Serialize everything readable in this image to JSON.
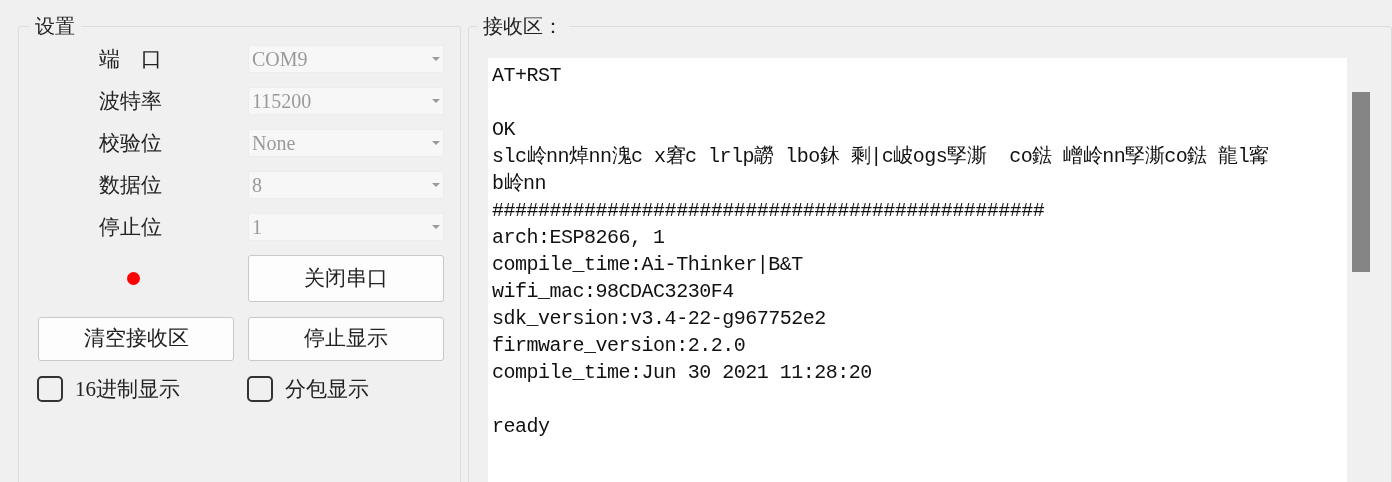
{
  "settings": {
    "title": "设置",
    "fields": [
      {
        "label": "端　口",
        "value": "COM9",
        "disabled": true
      },
      {
        "label": "波特率",
        "value": "115200",
        "disabled": true
      },
      {
        "label": "校验位",
        "value": "None",
        "disabled": true
      },
      {
        "label": "数据位",
        "value": "8",
        "disabled": true
      },
      {
        "label": "停止位",
        "value": "1",
        "disabled": true
      }
    ],
    "indicator": {
      "color": "#ff0000"
    },
    "open_button": "关闭串口",
    "buttons": [
      "清空接收区",
      "停止显示"
    ],
    "checkboxes": [
      {
        "label": "16进制显示",
        "checked": false
      },
      {
        "label": "分包显示",
        "checked": false
      }
    ]
  },
  "receive": {
    "title": "接收区：",
    "text": "AT+RST\n\nOK\nslc岭nn焯nn溾c x窘c lrlp髝 lbo鈢 剩|c岥ogs孯澌  co鍅 嶒岭nn孯澌co鍅 龍l寗\nb岭nn\n################################################\narch:ESP8266, 1\ncompile_time:Ai-Thinker|B&T\nwifi_mac:98CDAC3230F4\nsdk_version:v3.4-22-g967752e2\nfirmware_version:2.2.0\ncompile_time:Jun 30 2021 11:28:20\n\nready"
  }
}
